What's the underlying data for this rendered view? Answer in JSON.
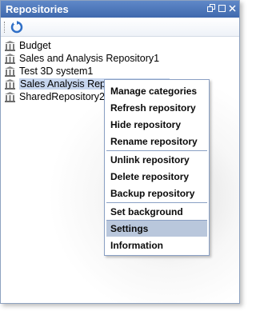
{
  "window": {
    "title": "Repositories"
  },
  "toolbar": {
    "refresh_icon": "refresh-icon"
  },
  "repositories": [
    {
      "label": "Budget"
    },
    {
      "label": "Sales and Analysis Repository1"
    },
    {
      "label": "Test 3D system1"
    },
    {
      "label": "Sales Analysis Repository Project"
    },
    {
      "label": "SharedRepository2"
    }
  ],
  "context_menu": {
    "items": [
      {
        "label": "Manage categories"
      },
      {
        "label": "Refresh repository"
      },
      {
        "label": "Hide repository"
      },
      {
        "label": "Rename repository"
      },
      {
        "label": "Unlink repository"
      },
      {
        "label": "Delete repository"
      },
      {
        "label": "Backup repository"
      },
      {
        "label": "Set background"
      },
      {
        "label": "Settings"
      },
      {
        "label": "Information"
      }
    ],
    "highlighted": "Settings"
  },
  "colors": {
    "title_bar": "#4f79bd",
    "highlight": "#b9c7dc",
    "selection": "#c7d6ee"
  }
}
